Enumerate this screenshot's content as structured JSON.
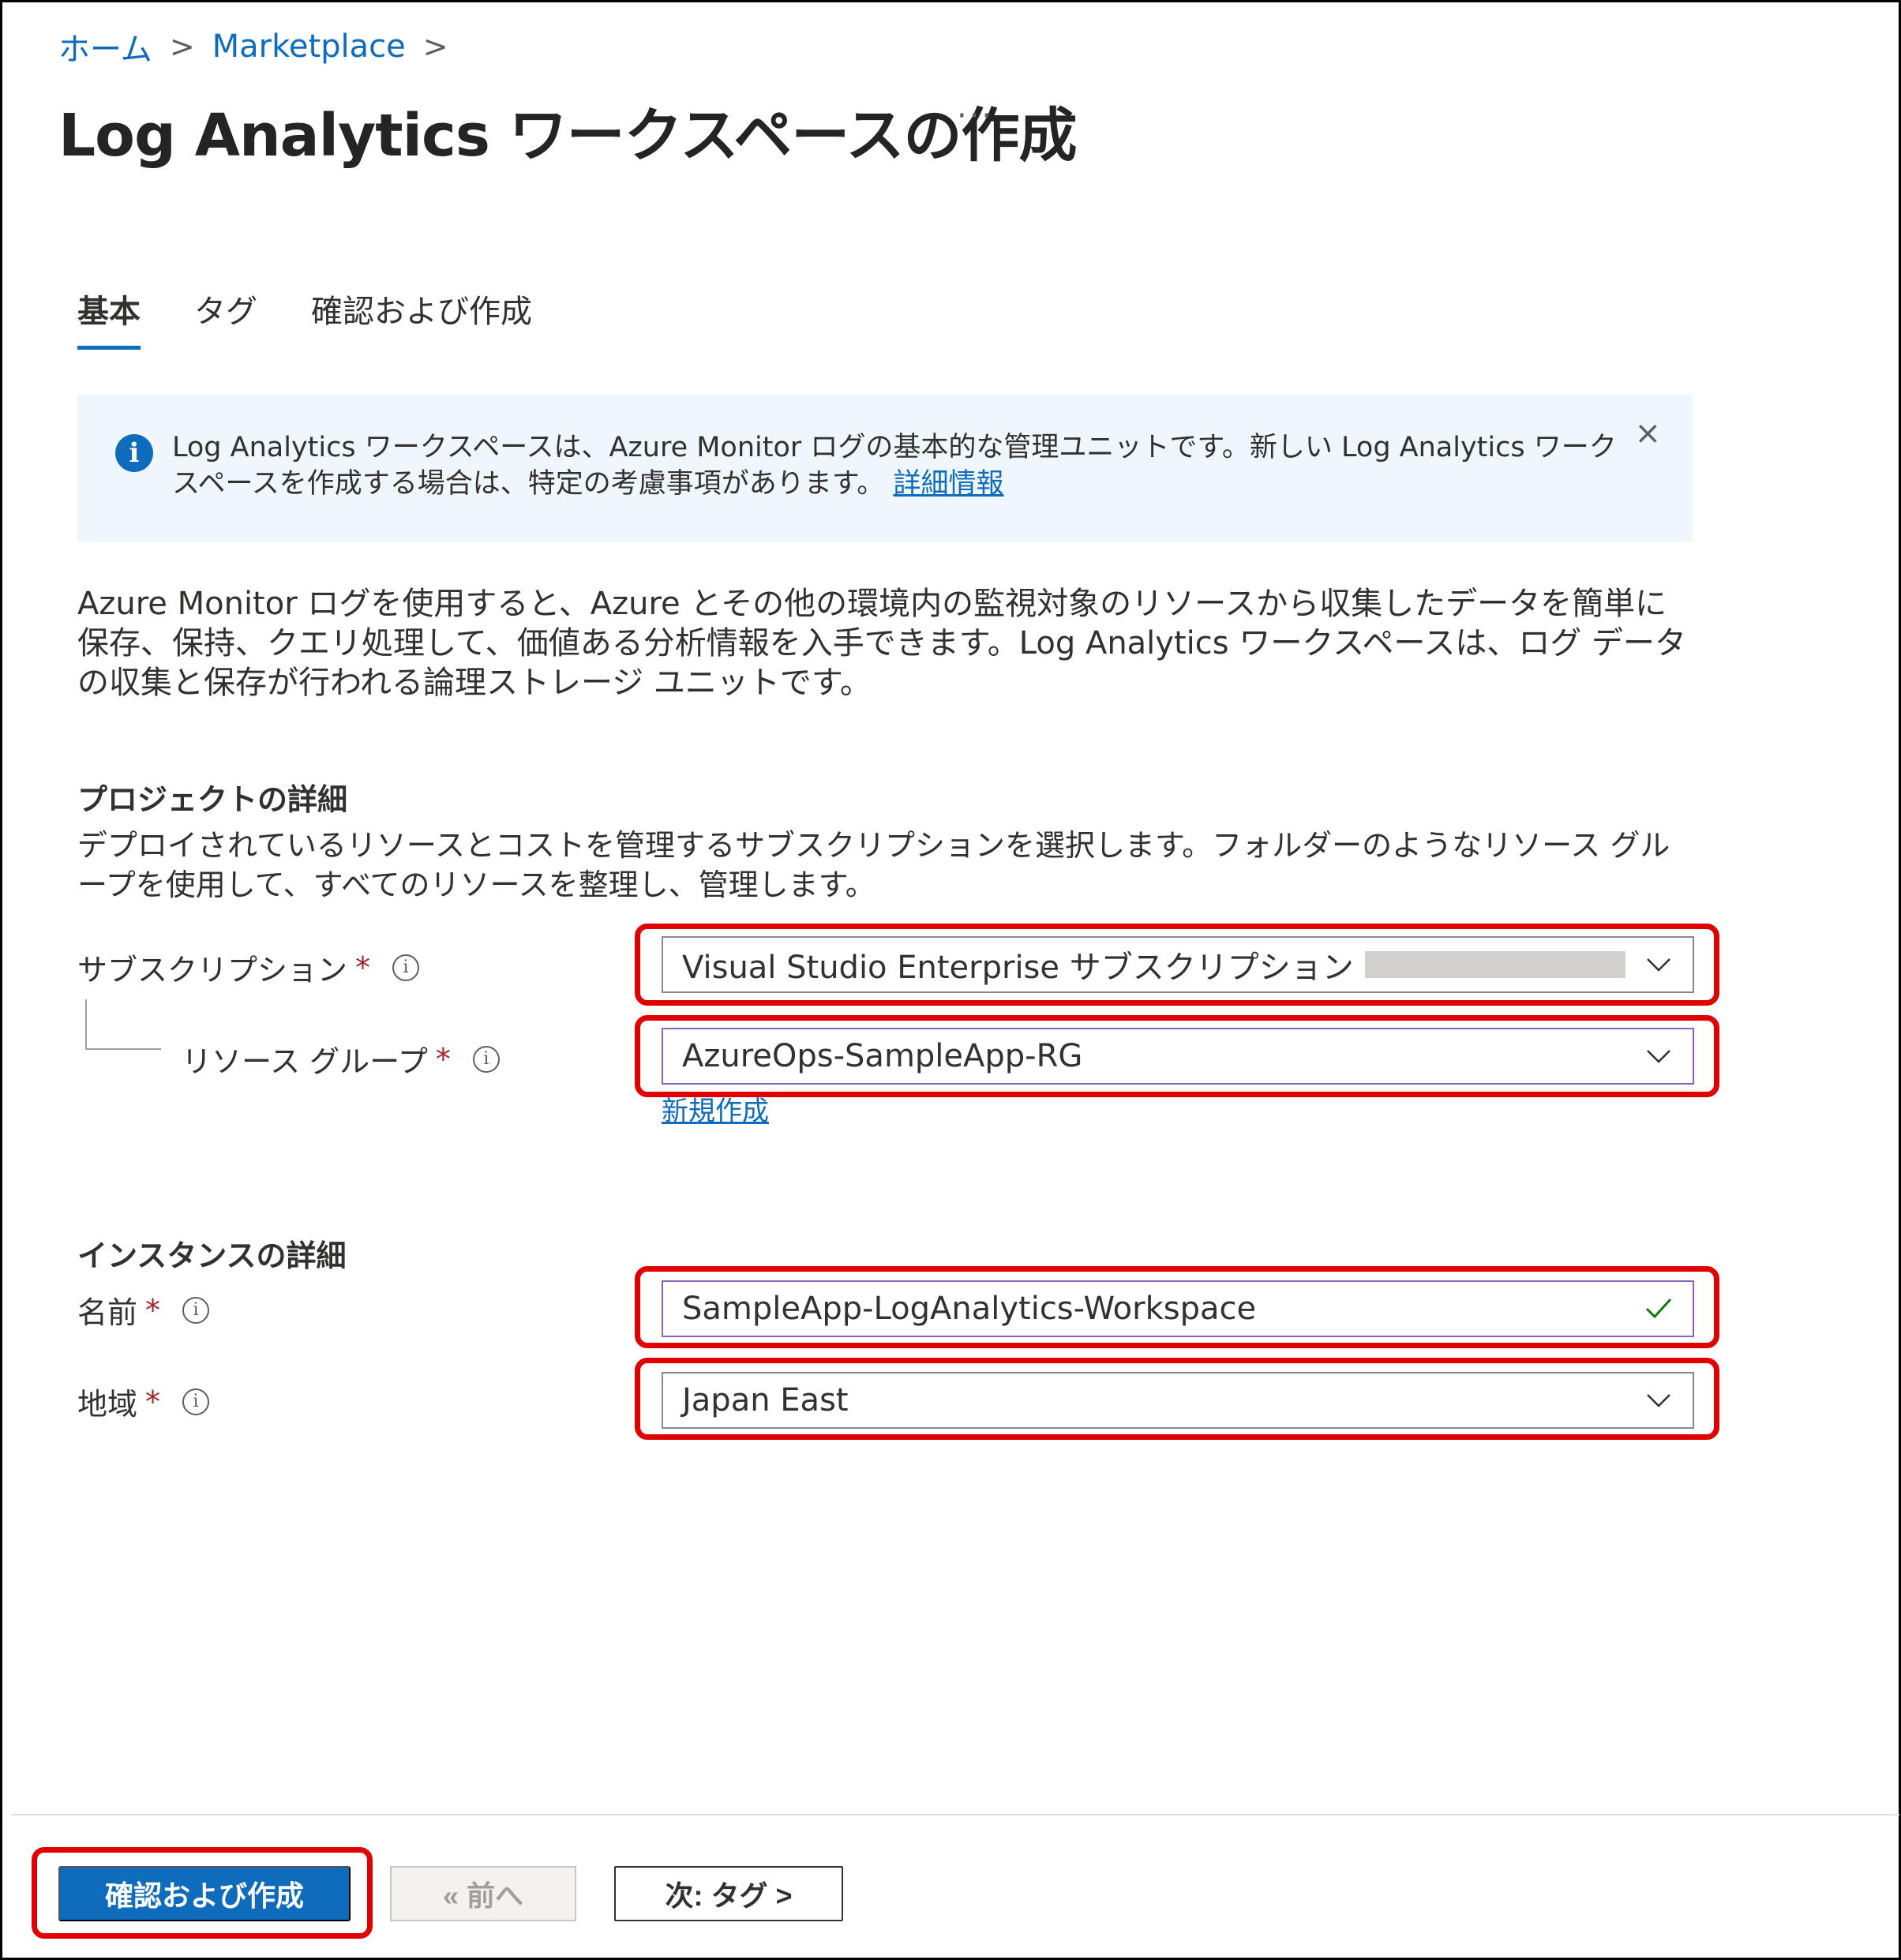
{
  "breadcrumb": {
    "home": "ホーム",
    "marketplace": "Marketplace",
    "separator": ">"
  },
  "header": {
    "title": "Log Analytics ワークスペースの作成",
    "more": "···"
  },
  "tabs": [
    {
      "label": "基本",
      "active": true
    },
    {
      "label": "タグ",
      "active": false
    },
    {
      "label": "確認および作成",
      "active": false
    }
  ],
  "info_banner": {
    "text": "Log Analytics ワークスペースは、Azure Monitor ログの基本的な管理ユニットです。新しい Log Analytics ワークスペースを作成する場合は、特定の考慮事項があります。",
    "link": "詳細情報",
    "close": "×"
  },
  "description": "Azure Monitor ログを使用すると、Azure とその他の環境内の監視対象のリソースから収集したデータを簡単に保存、保持、クエリ処理して、価値ある分析情報を入手できます。Log Analytics ワークスペースは、ログ データの収集と保存が行われる論理ストレージ ユニットです。",
  "project_details": {
    "title": "プロジェクトの詳細",
    "description": "デプロイされているリソースとコストを管理するサブスクリプションを選択します。フォルダーのようなリソース グループを使用して、すべてのリソースを整理し、管理します。",
    "subscription": {
      "label": "サブスクリプション",
      "value": "Visual Studio Enterprise サブスクリプション"
    },
    "resource_group": {
      "label": "リソース グループ",
      "value": "AzureOps-SampleApp-RG",
      "new_link": "新規作成"
    }
  },
  "instance_details": {
    "title": "インスタンスの詳細",
    "name": {
      "label": "名前",
      "value": "SampleApp-LogAnalytics-Workspace"
    },
    "region": {
      "label": "地域",
      "value": "Japan East"
    }
  },
  "required_mark": "*",
  "info_glyph": "i",
  "footer": {
    "review_create": "確認および作成",
    "previous": "« 前へ",
    "next": "次: タグ >"
  },
  "colors": {
    "accent": "#0f6cbd",
    "highlight": "#e00000",
    "banner_bg": "#eff6fc",
    "valid": "#107c10"
  }
}
